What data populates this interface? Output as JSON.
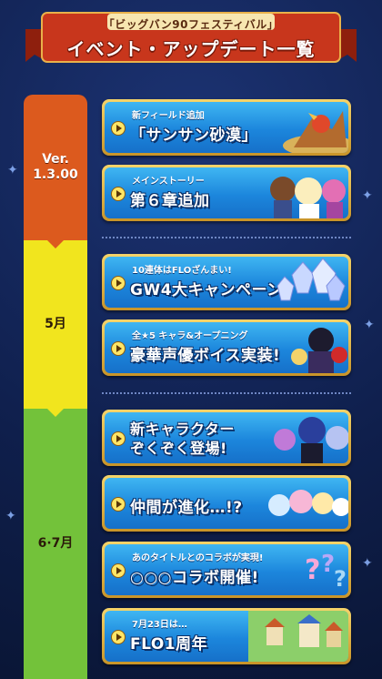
{
  "header": {
    "subtitle": "「ビッグバン90フェスティバル」",
    "title": "イベント・アップデート一覧"
  },
  "timeline": [
    {
      "label": "Ver.\n1.3.00",
      "color": "#dc5a1e"
    },
    {
      "label": "5月",
      "color": "#f1e51e"
    },
    {
      "label": "6·7月",
      "color": "#73c23a"
    }
  ],
  "cards": [
    {
      "small": "新フィールド追加",
      "big": "「サンサン砂漠」",
      "art": "desert-monster-art"
    },
    {
      "small": "メインストーリー",
      "big": "第６章追加",
      "art": "story-characters-art"
    },
    {
      "small": "10連体はFLOざんまい!",
      "big": "GW4大キャンペーン",
      "art": "crystals-art"
    },
    {
      "small": "全★5 キャラ&オープニング",
      "big": "豪華声優ボイス実装!",
      "art": "voice-characters-art"
    },
    {
      "small": "",
      "big": "新キャラクター\nぞくぞく登場!",
      "art": "new-characters-art"
    },
    {
      "small": "",
      "big": "仲間が進化…!?",
      "art": "evolve-characters-art"
    },
    {
      "small": "あのタイトルとのコラボが実現!",
      "big": "○○○コラボ開催!",
      "art": "question-marks-art"
    },
    {
      "small": "7月23日は…",
      "big": "FLO1周年",
      "art": "anniversary-town-art"
    }
  ],
  "colors": {
    "background": "#0f1f4c",
    "banner": "#c8361c",
    "card_blue": "#1c86dc",
    "card_border": "#e1b54a"
  }
}
